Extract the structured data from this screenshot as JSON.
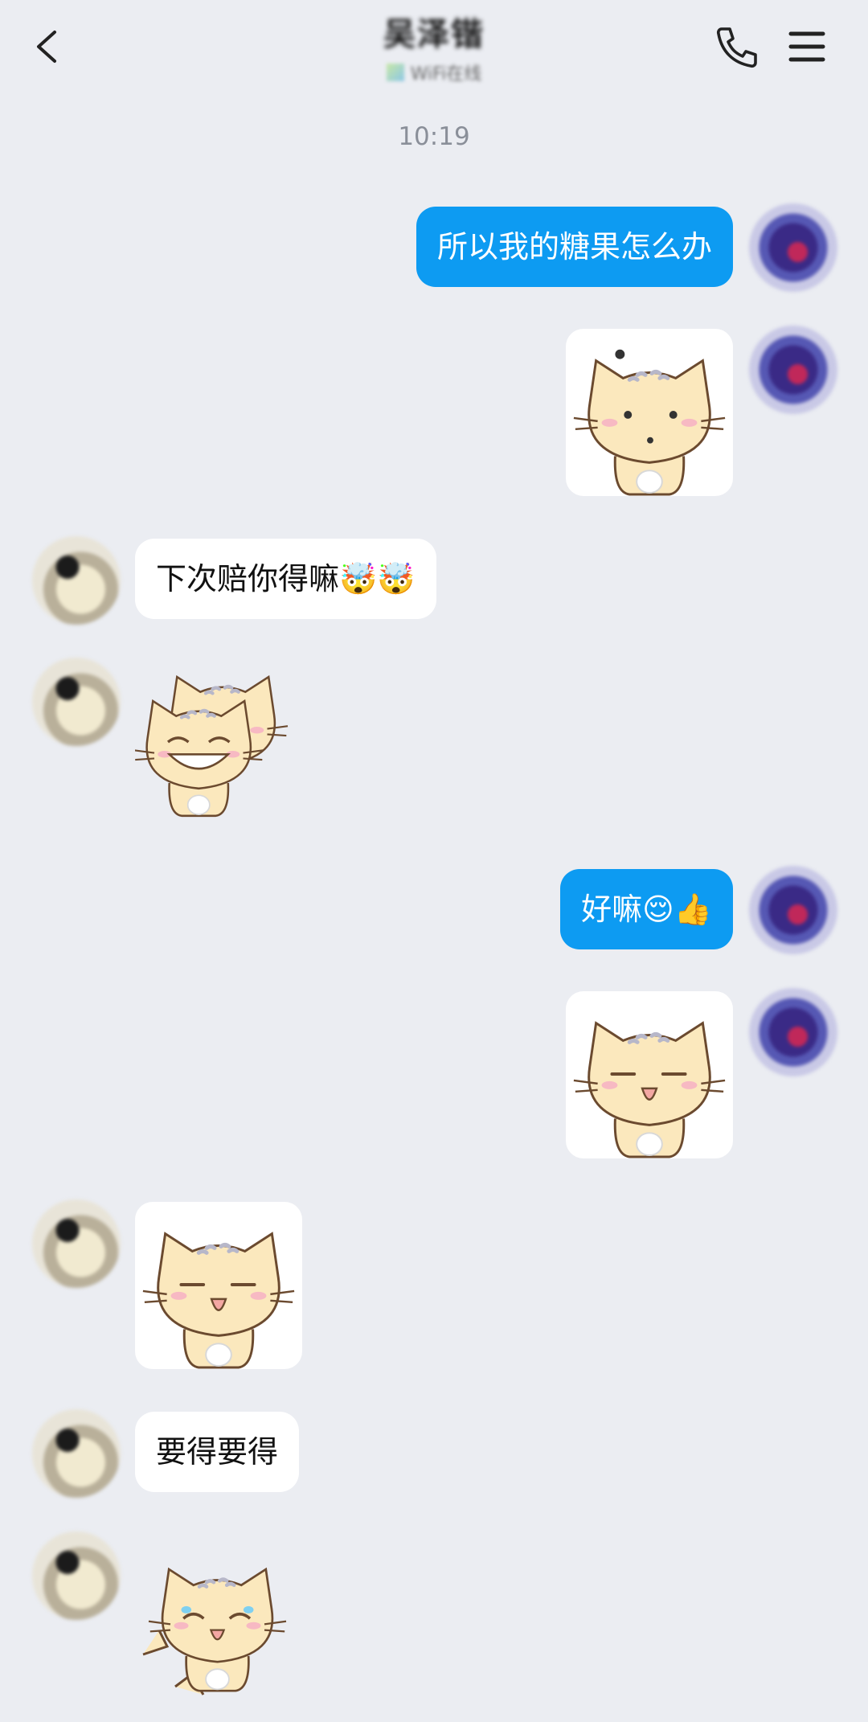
{
  "header": {
    "title": "吴泽锴",
    "status": "WiFi在线",
    "icons": {
      "back": "chevron-left-icon",
      "call": "phone-icon",
      "menu": "hamburger-menu-icon"
    }
  },
  "timestamp": "10:19",
  "messages": [
    {
      "from": "me",
      "type": "text",
      "text": "所以我的糖果怎么办"
    },
    {
      "from": "me",
      "type": "sticker",
      "sticker": "cat-sticker-surprised"
    },
    {
      "from": "other",
      "type": "text",
      "text": "下次赔你得嘛🤯🤯"
    },
    {
      "from": "other",
      "type": "sticker",
      "sticker": "cat-sticker-grin-double"
    },
    {
      "from": "me",
      "type": "text",
      "text": "好嘛😌👍"
    },
    {
      "from": "me",
      "type": "sticker",
      "sticker": "cat-sticker-happy"
    },
    {
      "from": "other",
      "type": "sticker",
      "sticker": "cat-sticker-happy"
    },
    {
      "from": "other",
      "type": "text",
      "text": "要得要得"
    },
    {
      "from": "other",
      "type": "sticker",
      "sticker": "cat-sticker-laugh-tears"
    }
  ],
  "colors": {
    "background": "#ebedf2",
    "my_bubble": "#0d9bf2",
    "their_bubble": "#ffffff"
  }
}
